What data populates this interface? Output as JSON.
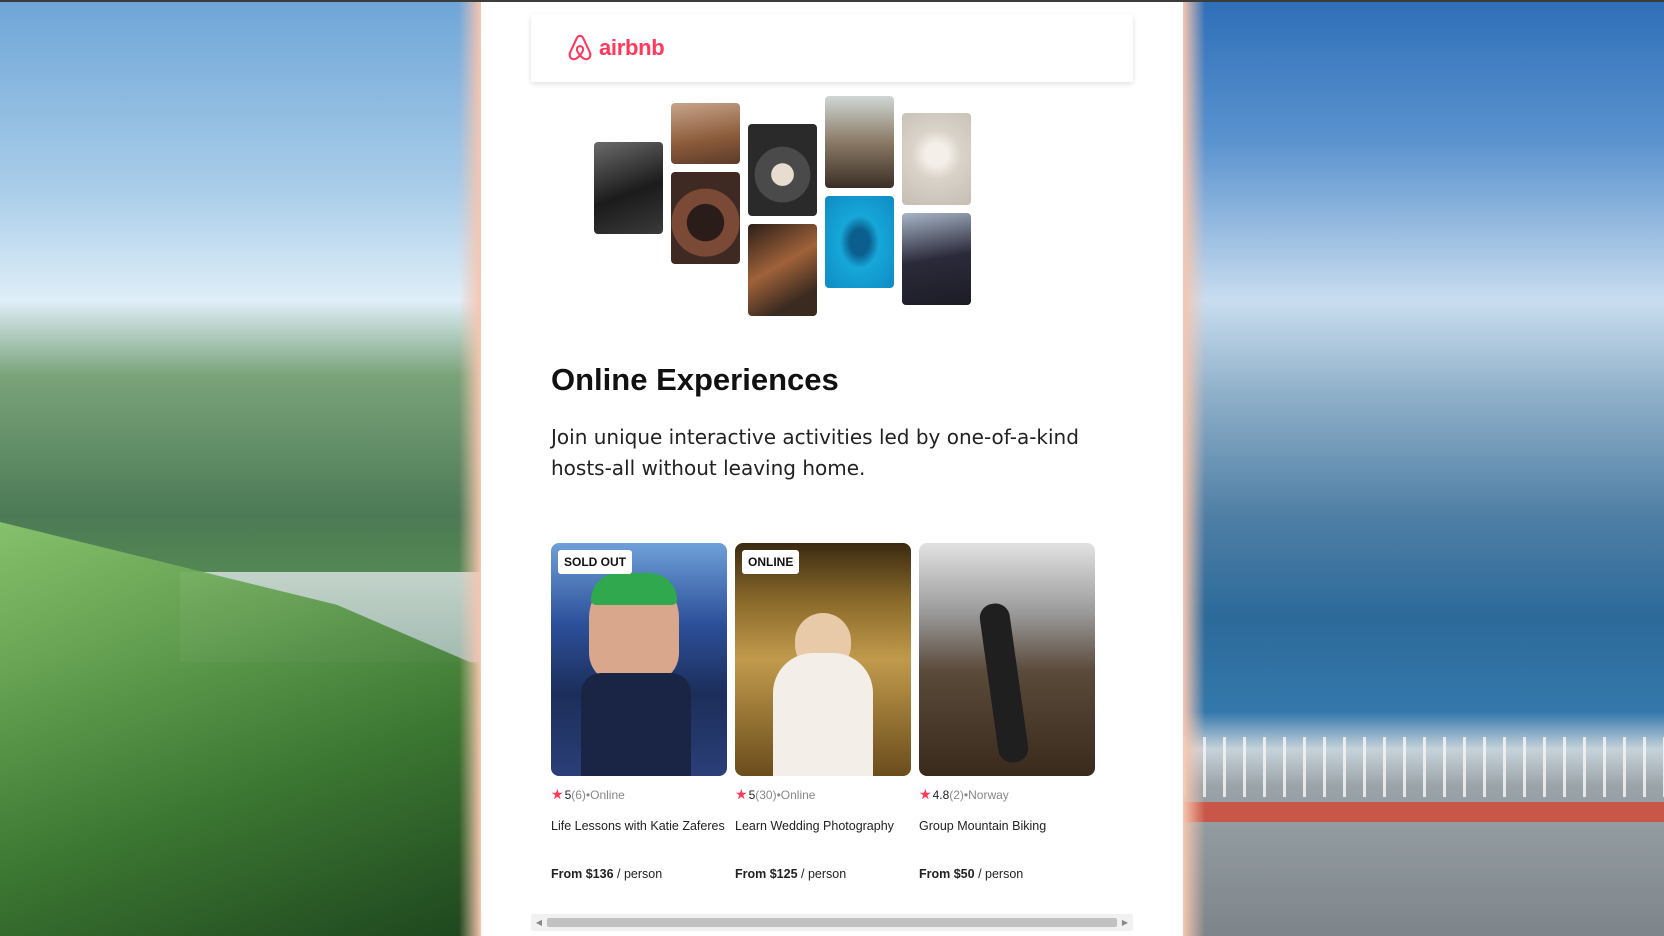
{
  "brand": {
    "name": "airbnb",
    "color": "#ff385c"
  },
  "hero": {
    "title": "Online Experiences",
    "subtitle": "Join unique interactive activities led by one-of-a-kind hosts-all without leaving home."
  },
  "cards": [
    {
      "badge": "SOLD OUT",
      "rating": "5",
      "reviews": "(6)",
      "location": "•Online",
      "title": "Life Lessons with Katie Zaferes",
      "price_prefix": "From $136",
      "price_suffix": "/ person"
    },
    {
      "badge": "ONLINE",
      "rating": "5",
      "reviews": "(30)",
      "location": "•Online",
      "title": "Learn Wedding Photography",
      "price_prefix": "From $125",
      "price_suffix": "/ person"
    },
    {
      "badge": "",
      "rating": "4.8",
      "reviews": "(2)",
      "location": "•Norway",
      "title": "Group Mountain Biking",
      "price_prefix": "From $50",
      "price_suffix": "/ person"
    }
  ],
  "collage_icons": [
    "cooking-photo",
    "woman-host-photo",
    "dancer-photo",
    "food-bowl-photo",
    "guitar-photo",
    "piano-singer-photo",
    "swimmer-photo",
    "yoga-photo",
    "singer-photo"
  ]
}
